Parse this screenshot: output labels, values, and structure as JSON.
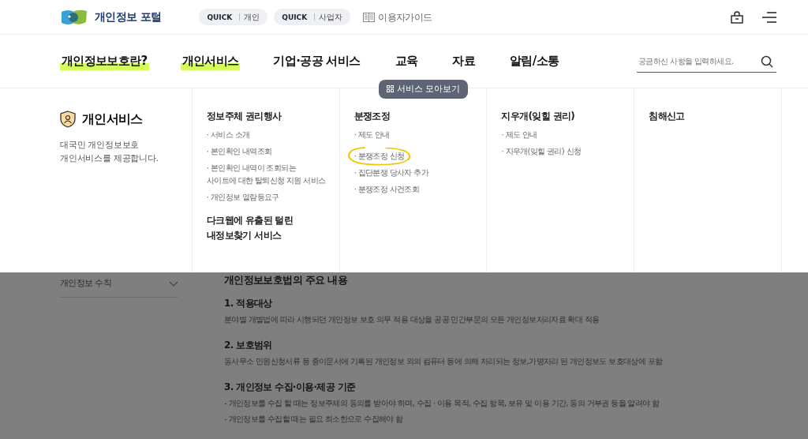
{
  "header": {
    "logo_text": "개인정보 포털",
    "quick_links": [
      {
        "tag": "QUICK",
        "label": "개인"
      },
      {
        "tag": "QUICK",
        "label": "사업자"
      }
    ],
    "guide": "이용자가이드"
  },
  "nav": {
    "items": [
      {
        "label": "개인정보보호란?",
        "highlighted": true
      },
      {
        "label": "개인서비스",
        "highlighted": true
      },
      {
        "label": "기업·공공 서비스",
        "highlighted": false
      },
      {
        "label": "교육",
        "highlighted": false
      },
      {
        "label": "자료",
        "highlighted": false
      },
      {
        "label": "알림/소통",
        "highlighted": false
      }
    ],
    "search": {
      "placeholder": "궁금하신 사항을 입력하세요."
    }
  },
  "mega_menu": {
    "toggle": "서비스 모아보기",
    "intro": {
      "title": "개인서비스",
      "description": "대국민 개인정보보호\n개인서비스를 제공합니다."
    },
    "columns": [
      {
        "groups": [
          {
            "title": "정보주체 권리행사",
            "links": [
              {
                "label": "· 서비스 소개",
                "circled": false
              },
              {
                "label": "· 본인확인 내역조회",
                "circled": false
              },
              {
                "label": "· 본인확인 내역이 조회되는\n사이트에 대한 탈퇴신청 지원 서비스",
                "circled": false
              },
              {
                "label": "· 개인정보 열람등요구",
                "circled": false
              }
            ]
          },
          {
            "title": "다크웹에 유출된 털린\n내정보찾기 서비스"
          }
        ]
      },
      {
        "groups": [
          {
            "title": "분쟁조정",
            "links": [
              {
                "label": "· 제도 안내",
                "circled": false
              },
              {
                "label": "· 분쟁조정 신청",
                "circled": true
              },
              {
                "label": "· 집단분쟁 당사자 추가",
                "circled": false
              },
              {
                "label": "· 분쟁조정 사건조회",
                "circled": false
              }
            ]
          }
        ]
      },
      {
        "groups": [
          {
            "title": "지우개(잊힐 권리)",
            "links": [
              {
                "label": "· 제도 안내",
                "circled": false
              },
              {
                "label": "· 지우개(잊힐 권리) 신청",
                "circled": false
              }
            ]
          }
        ]
      },
      {
        "groups": [
          {
            "title": "침해신고"
          }
        ]
      }
    ]
  },
  "sidebar": {
    "items": [
      {
        "label": "개인정보 수칙",
        "expanded": false
      }
    ]
  },
  "content": {
    "title": "개인정보보호법의 주요 내용",
    "sections": [
      {
        "heading": "1. 적용대상",
        "lines": [
          "분야별 개별법에 따라 시행되던 개인정보 보호 의무 적용 대상을 공공 민간부문의 모든 개인정보처리자료 확대 적용"
        ]
      },
      {
        "heading": "2. 보호범위",
        "lines": [
          "동사무소 민원신청서류 등 종이문서에 기록된 개인정보 외의 컴퓨터 등에 의해 처리되는 정보,가명처리 된 개인정보도 보호대상에 포함"
        ]
      },
      {
        "heading": "3. 개인정보 수집·이용·제공 기준",
        "lines": [
          "- 개인정보를 수집 할 때는 정보주체의 동의를 받아야 하며, 수집 · 이용 목적, 수집 항목, 보유 및 이용 기간, 동의 거부권 등을 알려야 함",
          "- 개인정보를 수집할 때는 필요 최소한으로 수집해야 함"
        ]
      }
    ]
  }
}
